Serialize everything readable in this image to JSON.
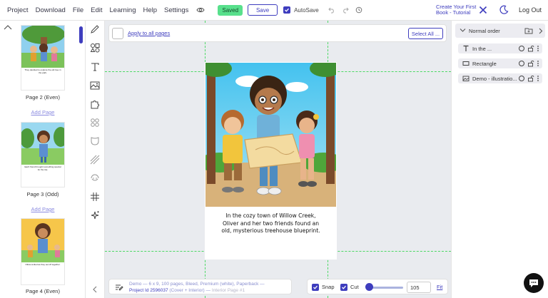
{
  "menu": [
    "Project",
    "Download",
    "File",
    "Edit",
    "Learning",
    "Help",
    "Settings"
  ],
  "status": {
    "saved": "Saved",
    "save": "Save",
    "autosave": "AutoSave"
  },
  "tutorial": {
    "line1": "Create Your First",
    "line2": "Book - Tutorial"
  },
  "auth": {
    "logout": "Log Out"
  },
  "thumbnails": [
    {
      "label": "Page 2 (Even)",
      "text": "They decided to explore the old tree in the park."
    },
    {
      "label": "Page 3 (Odd)",
      "text": "Each friend brought something special for the trip."
    },
    {
      "label": "Page 4 (Even)",
      "text": "Olivia smiled as they set off together."
    }
  ],
  "add_page": "Add Page",
  "canvas": {
    "apply_all": "Apply to all pages",
    "select_all": "Select All ...",
    "page_text": "In the cozy town of Willow Creek, Oliver and her two friends found an old, mysterious treehouse blueprint."
  },
  "info": {
    "line1": "Demo — 6 x 9, 100 pages, Bleed, Premium (white), Paperback —",
    "project": "Project Id 2596037",
    "mid": " (Cover + Interior) — ",
    "page": "Interior Page #1"
  },
  "controls": {
    "snap": "Snap",
    "cut": "Cut",
    "zoom": "105",
    "fit": "Fit",
    "zoom_level": 0.2
  },
  "layers": {
    "order_label": "Normal order",
    "items": [
      {
        "name": "In the ...",
        "icon": "text-icon"
      },
      {
        "name": "Rectangle",
        "icon": "rectangle-icon"
      },
      {
        "name": "Demo - illustratio...",
        "icon": "image-icon"
      }
    ]
  },
  "colors": {
    "accent": "#3e3dbe",
    "saved": "#58e08c",
    "guide": "#4cd964",
    "canvas_bg": "#e9ebef"
  }
}
